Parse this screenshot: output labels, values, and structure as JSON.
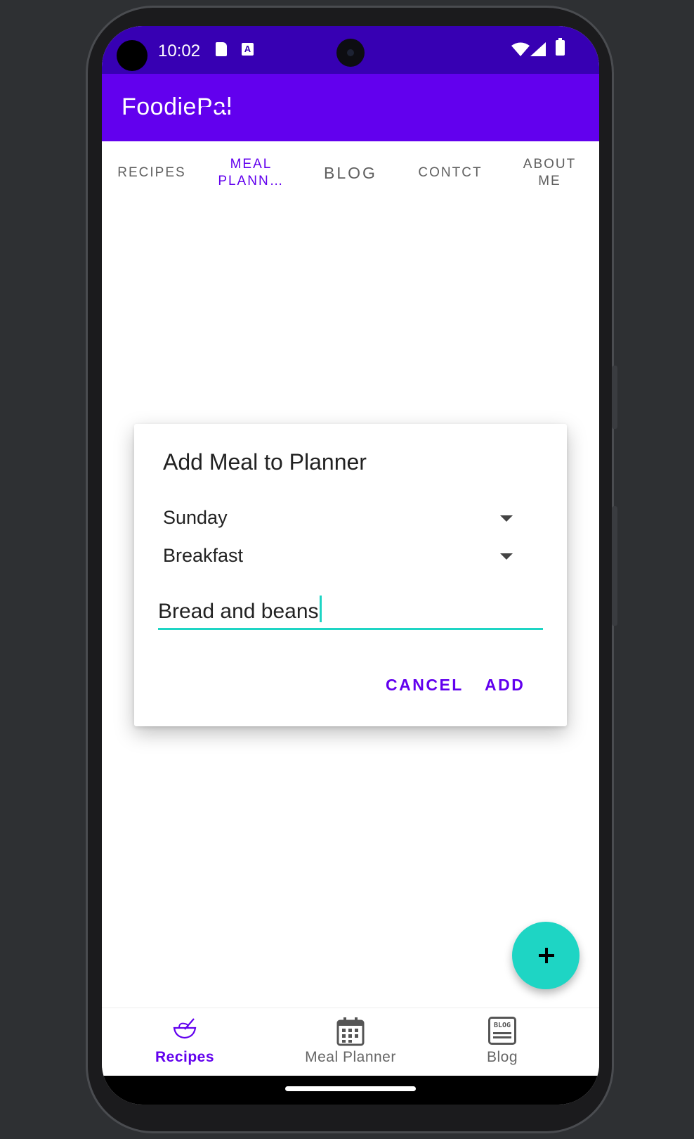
{
  "status_bar": {
    "time": "10:02",
    "sd_icon": "sd-card-icon",
    "a_icon": "A"
  },
  "app": {
    "title": "FoodiePal"
  },
  "tabs": [
    {
      "label": "RECIPES"
    },
    {
      "label": "MEAL\nPLANN…",
      "active": true
    },
    {
      "label": "BLOG"
    },
    {
      "label": "CONTCT"
    },
    {
      "label": "ABOUT\nME"
    }
  ],
  "dialog": {
    "title": "Add Meal to Planner",
    "day_value": "Sunday",
    "meal_type_value": "Breakfast",
    "meal_input_value": "Bread and beans",
    "cancel_label": "CANCEL",
    "add_label": "ADD"
  },
  "fab": {
    "icon": "plus-icon"
  },
  "bottom_nav": [
    {
      "label": "Recipes",
      "icon": "mixing-bowl-icon",
      "active": true
    },
    {
      "label": "Meal Planner",
      "icon": "calendar-icon"
    },
    {
      "label": "Blog",
      "icon": "blog-icon",
      "icon_text": "BLOG"
    }
  ],
  "colors": {
    "primary": "#6200ee",
    "primary_dark": "#3700b3",
    "accent": "#1ed5c4"
  }
}
